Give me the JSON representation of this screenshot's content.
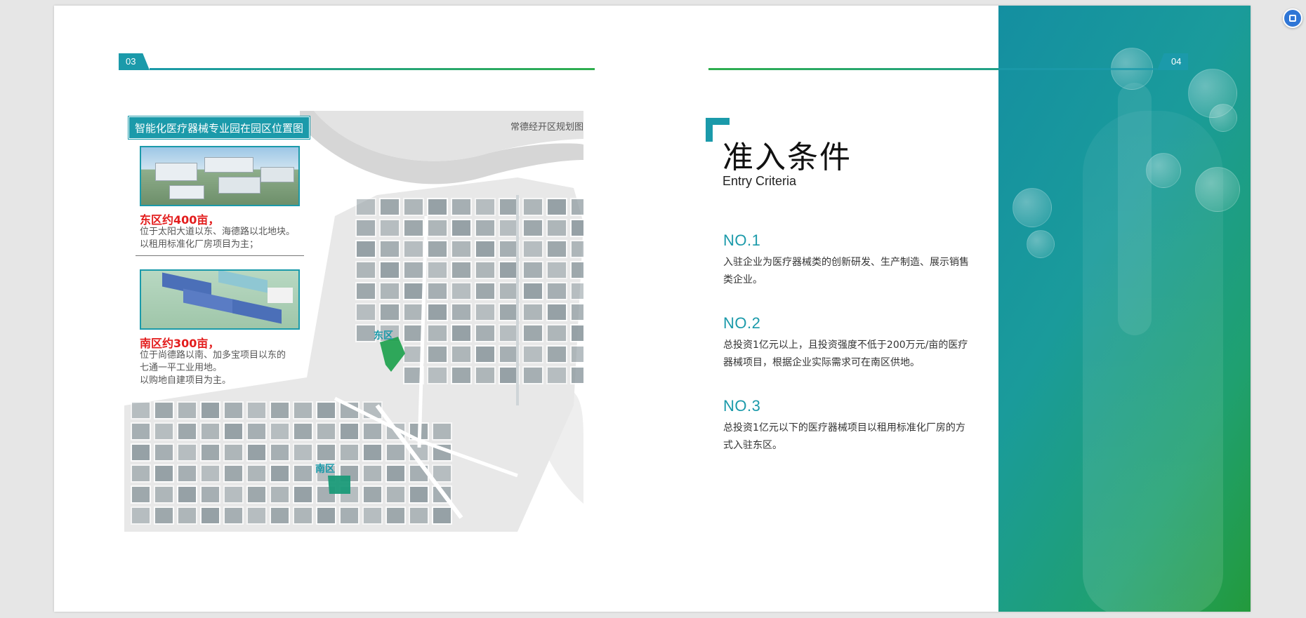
{
  "pages": {
    "left_number": "03",
    "right_number": "04"
  },
  "map": {
    "caption": "常德经开区规划图",
    "park_title": "智能化医疗器械专业园在园区位置图",
    "east": {
      "heading": "东区约400亩，",
      "lines": [
        "位于太阳大道以东、海德路以北地块。",
        "以租用标准化厂房项目为主；"
      ],
      "label": "东区"
    },
    "south": {
      "heading": "南区约300亩，",
      "lines": [
        "位于尚德路以南、加多宝项目以东的",
        "七通一平工业用地。",
        "以购地自建项目为主。"
      ],
      "label": "南区"
    }
  },
  "entry": {
    "title": "准入条件",
    "subtitle": "Entry Criteria",
    "items": [
      {
        "no": "NO.1",
        "text": "入驻企业为医疗器械类的创新研发、生产制造、展示销售类企业。"
      },
      {
        "no": "NO.2",
        "text": "总投资1亿元以上，且投资强度不低于200万元/亩的医疗器械项目，根据企业实际需求可在南区供地。"
      },
      {
        "no": "NO.3",
        "text": "总投资1亿元以下的医疗器械项目以租用标准化厂房的方式入驻东区。"
      }
    ]
  },
  "colors": {
    "accent": "#1b9aaa",
    "green": "#2fae4e",
    "highlight_red": "#e31d1d"
  },
  "icons": {
    "floating_button": "translate-icon"
  }
}
